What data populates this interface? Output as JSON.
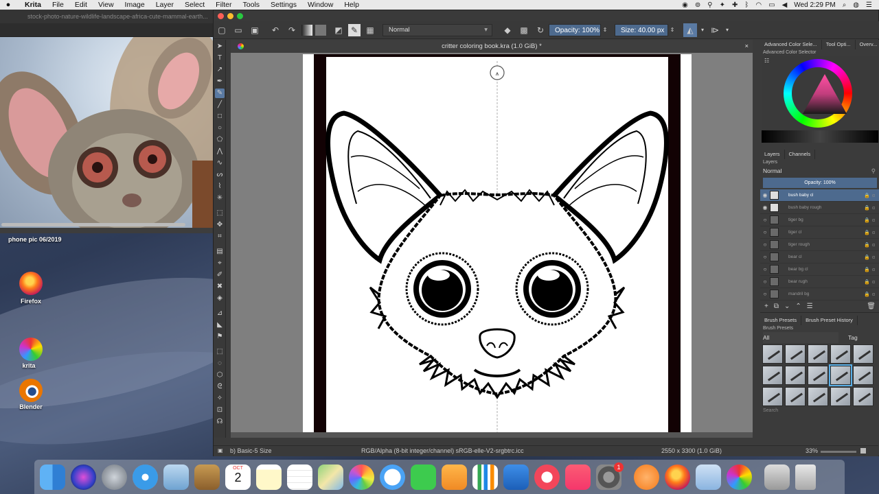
{
  "menubar": {
    "app_name": "Krita",
    "menus": [
      "File",
      "Edit",
      "View",
      "Image",
      "Layer",
      "Select",
      "Filter",
      "Tools",
      "Settings",
      "Window",
      "Help"
    ],
    "clock": "Wed 2:29 PM"
  },
  "browser": {
    "tab_title": "stock-photo-nature-wildlife-landscape-africa-cute-mammal-earth..."
  },
  "desktop": {
    "photo_caption": "phone pic 06/2019",
    "icons": [
      {
        "label": "Firefox",
        "icon": "firefox-icon"
      },
      {
        "label": "krita",
        "icon": "krita-icon"
      },
      {
        "label": "Blender",
        "icon": "blender-icon"
      }
    ]
  },
  "krita": {
    "blend_mode": "Normal",
    "opacity_label": "Opacity:  100%",
    "size_label": "Size:  40.00 px",
    "document_title": "critter coloring book.kra (1.0 GiB) *",
    "dockers": {
      "top_tabs": [
        "Advanced Color Sele...",
        "Tool Opti...",
        "Overv..."
      ],
      "color_title": "Advanced Color Selector",
      "layer_tabs": [
        "Layers",
        "Channels"
      ],
      "layers_title": "Layers",
      "layer_blend": "Normal",
      "layer_opacity": "Opacity:  100%",
      "layers": [
        {
          "name": "bush baby cl",
          "visible": true,
          "active": true
        },
        {
          "name": "bush baby rough",
          "visible": true,
          "active": false
        },
        {
          "name": "tiger bg",
          "visible": false,
          "active": false
        },
        {
          "name": "tiger cl",
          "visible": false,
          "active": false
        },
        {
          "name": "tiger rough",
          "visible": false,
          "active": false
        },
        {
          "name": "bear cl",
          "visible": false,
          "active": false
        },
        {
          "name": "bear bg cl",
          "visible": false,
          "active": false
        },
        {
          "name": "bear rugh",
          "visible": false,
          "active": false
        },
        {
          "name": "mandril bg",
          "visible": false,
          "active": false
        }
      ],
      "brush_tabs": [
        "Brush Presets",
        "Brush Preset History"
      ],
      "brush_title": "Brush Presets",
      "brush_filter": "All",
      "tag_label": "Tag",
      "search_placeholder": "Search"
    },
    "status": {
      "brush": "b) Basic-5 Size",
      "color_space": "RGB/Alpha (8-bit integer/channel)  sRGB-elle-V2-srgbtrc.icc",
      "dimensions": "2550 x 3300 (1.0 GiB)",
      "zoom": "33%"
    }
  },
  "dock": {
    "calendar_month": "OCT",
    "calendar_day": "2",
    "notification_badge": "1",
    "apps": [
      "finder-icon",
      "siri-icon",
      "launchpad-icon",
      "safari-icon",
      "mail-icon",
      "notes-icon",
      "calendar-icon",
      "stickies-icon",
      "reminders-icon",
      "maps-icon",
      "photos-icon",
      "messages-icon",
      "facetime-icon",
      "pages-icon",
      "numbers-icon",
      "keynote-icon",
      "news-icon",
      "music-icon",
      "system-preferences-icon",
      "search-icon",
      "firefox-icon",
      "preview-icon",
      "krita-icon",
      "screenshot-icon",
      "trash-icon"
    ]
  },
  "colors": {
    "accent": "#4d6a8e",
    "canvas_gray": "#7f7f7f",
    "page_border": "#120204"
  }
}
